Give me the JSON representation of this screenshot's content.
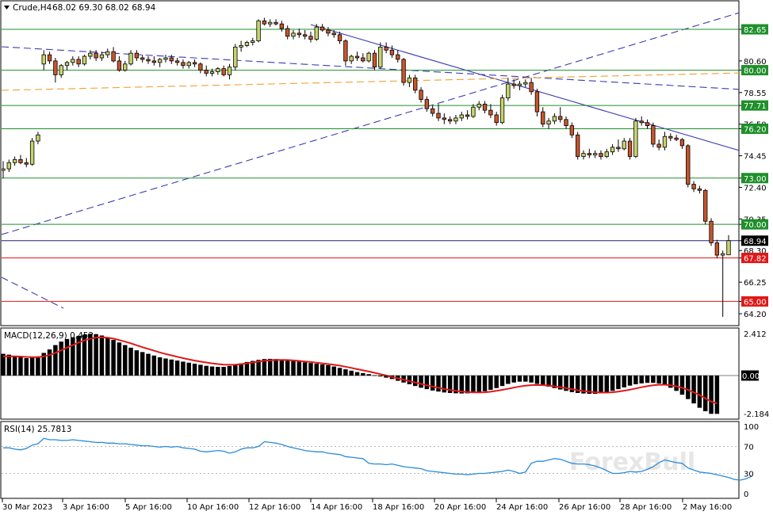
{
  "header": {
    "symbol": "Crude,H4",
    "ohlc": "68.02 69.30 68.02 68.94",
    "macd_label": "MACD(12,26,9) 0.452",
    "rsi_label": "RSI(14) 25.7813"
  },
  "watermark": "ForexBull",
  "colors": {
    "bull": "#c8d46a",
    "bear": "#c8552b",
    "level_green": "#1f8f2a",
    "level_red": "#e01818",
    "current_price": "#1e1e7a",
    "trendline": "#3a3ab4",
    "ma_orange": "#f0a030",
    "macd_signal": "#e01818",
    "rsi_line": "#2a8ad8"
  },
  "chart_data": [
    {
      "type": "candlestick",
      "title": "Crude,H4",
      "y_ticks": [
        "82.65",
        "80.60",
        "80.00",
        "78.55",
        "77.71",
        "76.50",
        "76.20",
        "74.45",
        "73.00",
        "72.40",
        "70.35",
        "70.00",
        "68.94",
        "68.30",
        "67.82",
        "66.25",
        "65.00",
        "64.20"
      ],
      "ylim": [
        63.2,
        84.3
      ],
      "x_labels": [
        "30 Mar 2023",
        "3 Apr 16:00",
        "5 Apr 16:00",
        "10 Apr 16:00",
        "12 Apr 16:00",
        "14 Apr 16:00",
        "18 Apr 16:00",
        "20 Apr 16:00",
        "24 Apr 16:00",
        "26 Apr 16:00",
        "28 Apr 16:00",
        "2 May 16:00"
      ],
      "horizontal_levels": [
        {
          "label": "82.65",
          "value": 82.65,
          "color": "green"
        },
        {
          "label": "80.00",
          "value": 80.0,
          "color": "green"
        },
        {
          "label": "77.71",
          "value": 77.71,
          "color": "green"
        },
        {
          "label": "76.20",
          "value": 76.2,
          "color": "green"
        },
        {
          "label": "73.00",
          "value": 73.0,
          "color": "green"
        },
        {
          "label": "70.00",
          "value": 70.0,
          "color": "green"
        },
        {
          "label": "68.94",
          "value": 68.94,
          "color": "current"
        },
        {
          "label": "67.82",
          "value": 67.82,
          "color": "red"
        },
        {
          "label": "65.00",
          "value": 65.0,
          "color": "red"
        }
      ],
      "candles": [
        [
          73.5,
          74.1,
          73.0,
          73.6
        ],
        [
          73.6,
          74.2,
          73.4,
          74.0
        ],
        [
          74.0,
          74.4,
          73.8,
          74.2
        ],
        [
          74.2,
          74.5,
          73.9,
          74.0
        ],
        [
          74.0,
          74.3,
          73.7,
          73.9
        ],
        [
          73.9,
          75.6,
          73.8,
          75.4
        ],
        [
          75.4,
          76.0,
          75.2,
          75.8
        ],
        [
          80.4,
          81.3,
          80.0,
          81.0
        ],
        [
          81.0,
          81.2,
          80.4,
          80.6
        ],
        [
          80.6,
          80.8,
          79.2,
          79.7
        ],
        [
          79.7,
          80.4,
          79.5,
          80.3
        ],
        [
          80.3,
          80.6,
          80.0,
          80.5
        ],
        [
          80.5,
          80.9,
          80.3,
          80.7
        ],
        [
          80.7,
          80.9,
          80.2,
          80.4
        ],
        [
          80.4,
          81.0,
          80.3,
          80.9
        ],
        [
          80.9,
          81.3,
          80.7,
          81.1
        ],
        [
          81.1,
          81.3,
          80.6,
          80.8
        ],
        [
          80.8,
          81.2,
          80.6,
          81.0
        ],
        [
          81.0,
          81.4,
          80.8,
          81.2
        ],
        [
          81.2,
          81.5,
          80.5,
          80.6
        ],
        [
          80.6,
          80.9,
          79.9,
          80.0
        ],
        [
          80.0,
          80.6,
          79.9,
          80.4
        ],
        [
          80.4,
          81.3,
          80.3,
          81.1
        ],
        [
          81.1,
          81.3,
          80.6,
          80.8
        ],
        [
          80.8,
          81.0,
          80.5,
          80.7
        ],
        [
          80.7,
          80.9,
          80.4,
          80.6
        ],
        [
          80.6,
          80.9,
          80.3,
          80.5
        ],
        [
          80.5,
          80.8,
          80.2,
          80.7
        ],
        [
          80.7,
          81.0,
          80.5,
          80.8
        ],
        [
          80.8,
          81.0,
          80.4,
          80.6
        ],
        [
          80.6,
          80.8,
          80.3,
          80.5
        ],
        [
          80.5,
          80.7,
          80.1,
          80.3
        ],
        [
          80.3,
          80.6,
          80.1,
          80.5
        ],
        [
          80.5,
          80.7,
          80.2,
          80.4
        ],
        [
          80.4,
          80.5,
          79.8,
          80.0
        ],
        [
          80.0,
          80.3,
          79.6,
          79.8
        ],
        [
          79.8,
          80.1,
          79.6,
          79.9
        ],
        [
          79.9,
          80.2,
          79.7,
          80.1
        ],
        [
          80.1,
          80.3,
          79.6,
          79.7
        ],
        [
          79.7,
          80.4,
          79.4,
          80.2
        ],
        [
          80.2,
          81.7,
          80.0,
          81.5
        ],
        [
          81.5,
          81.9,
          81.2,
          81.6
        ],
        [
          81.6,
          81.9,
          81.5,
          81.8
        ],
        [
          81.8,
          82.1,
          81.6,
          81.9
        ],
        [
          81.9,
          83.3,
          81.8,
          83.2
        ],
        [
          83.2,
          83.4,
          82.9,
          83.0
        ],
        [
          83.0,
          83.3,
          82.8,
          83.1
        ],
        [
          83.1,
          83.3,
          82.9,
          83.0
        ],
        [
          83.0,
          83.2,
          82.5,
          82.7
        ],
        [
          82.7,
          82.9,
          82.0,
          82.2
        ],
        [
          82.2,
          82.6,
          82.0,
          82.4
        ],
        [
          82.4,
          82.7,
          82.1,
          82.3
        ],
        [
          82.3,
          82.6,
          82.0,
          82.2
        ],
        [
          82.2,
          82.5,
          81.8,
          82.0
        ],
        [
          82.0,
          83.0,
          81.9,
          82.8
        ],
        [
          82.8,
          83.0,
          82.5,
          82.6
        ],
        [
          82.6,
          82.8,
          82.2,
          82.4
        ],
        [
          82.4,
          82.6,
          82.1,
          82.3
        ],
        [
          82.3,
          82.5,
          81.7,
          81.9
        ],
        [
          81.9,
          82.0,
          80.3,
          80.6
        ],
        [
          80.6,
          81.0,
          80.4,
          80.9
        ],
        [
          80.9,
          81.2,
          80.6,
          80.8
        ],
        [
          80.8,
          81.1,
          80.5,
          80.6
        ],
        [
          80.6,
          81.2,
          80.5,
          81.1
        ],
        [
          81.1,
          81.3,
          80.0,
          80.2
        ],
        [
          80.2,
          81.8,
          80.1,
          81.5
        ],
        [
          81.5,
          81.8,
          81.1,
          81.3
        ],
        [
          81.3,
          81.6,
          80.8,
          81.0
        ],
        [
          81.0,
          81.3,
          80.5,
          80.7
        ],
        [
          80.7,
          80.8,
          79.0,
          79.2
        ],
        [
          79.2,
          79.7,
          78.9,
          79.5
        ],
        [
          79.5,
          79.7,
          78.5,
          78.7
        ],
        [
          78.7,
          78.9,
          77.9,
          78.1
        ],
        [
          78.1,
          78.3,
          77.3,
          77.5
        ],
        [
          77.5,
          77.7,
          77.0,
          77.2
        ],
        [
          77.2,
          77.8,
          76.7,
          76.9
        ],
        [
          76.9,
          77.2,
          76.5,
          76.8
        ],
        [
          76.8,
          77.0,
          76.5,
          76.7
        ],
        [
          76.7,
          77.1,
          76.5,
          76.9
        ],
        [
          76.9,
          77.3,
          76.7,
          77.1
        ],
        [
          77.1,
          77.4,
          76.8,
          77.0
        ],
        [
          77.0,
          77.8,
          76.9,
          77.6
        ],
        [
          77.6,
          78.0,
          77.4,
          77.8
        ],
        [
          77.8,
          78.0,
          77.2,
          77.4
        ],
        [
          77.4,
          77.8,
          76.9,
          77.1
        ],
        [
          77.1,
          77.3,
          76.4,
          76.6
        ],
        [
          76.6,
          78.4,
          76.5,
          78.2
        ],
        [
          78.2,
          79.5,
          78.0,
          79.1
        ],
        [
          79.1,
          79.4,
          78.8,
          79.0
        ],
        [
          79.0,
          79.3,
          78.7,
          79.1
        ],
        [
          79.1,
          79.4,
          78.9,
          79.2
        ],
        [
          79.2,
          79.5,
          78.4,
          78.6
        ],
        [
          78.6,
          78.8,
          77.0,
          77.3
        ],
        [
          77.3,
          77.6,
          76.3,
          76.5
        ],
        [
          76.5,
          76.9,
          76.2,
          76.7
        ],
        [
          76.7,
          77.2,
          76.5,
          77.0
        ],
        [
          77.0,
          77.6,
          76.6,
          76.8
        ],
        [
          76.8,
          77.0,
          76.2,
          76.4
        ],
        [
          76.4,
          76.6,
          75.6,
          75.8
        ],
        [
          75.8,
          76.0,
          74.2,
          74.4
        ],
        [
          74.4,
          74.8,
          74.2,
          74.6
        ],
        [
          74.6,
          74.9,
          74.3,
          74.5
        ],
        [
          74.5,
          74.8,
          74.3,
          74.6
        ],
        [
          74.6,
          74.8,
          74.2,
          74.4
        ],
        [
          74.4,
          74.9,
          74.3,
          74.7
        ],
        [
          74.7,
          75.2,
          74.5,
          75.0
        ],
        [
          75.0,
          75.5,
          74.7,
          74.9
        ],
        [
          74.9,
          75.6,
          74.8,
          75.4
        ],
        [
          75.4,
          75.6,
          74.2,
          74.4
        ],
        [
          74.4,
          76.9,
          74.3,
          76.7
        ],
        [
          76.7,
          77.0,
          76.4,
          76.6
        ],
        [
          76.6,
          76.8,
          76.2,
          76.4
        ],
        [
          76.4,
          76.6,
          75.0,
          75.2
        ],
        [
          75.2,
          75.5,
          74.8,
          75.0
        ],
        [
          75.0,
          76.0,
          74.8,
          75.7
        ],
        [
          75.7,
          75.9,
          75.4,
          75.6
        ],
        [
          75.6,
          75.8,
          75.4,
          75.5
        ],
        [
          75.5,
          75.6,
          74.9,
          75.1
        ],
        [
          75.1,
          75.2,
          72.4,
          72.6
        ],
        [
          72.6,
          72.8,
          72.1,
          72.3
        ],
        [
          72.3,
          72.5,
          72.0,
          72.2
        ],
        [
          72.2,
          72.3,
          70.0,
          70.2
        ],
        [
          70.2,
          70.4,
          68.6,
          68.8
        ],
        [
          68.8,
          69.0,
          67.8,
          68.0
        ],
        [
          68.0,
          68.3,
          64.0,
          68.1
        ],
        [
          68.02,
          69.3,
          68.02,
          68.94
        ]
      ],
      "trendlines": [
        {
          "name": "downtrend",
          "style": "solid"
        },
        {
          "name": "long descending",
          "style": "dashed"
        },
        {
          "name": "ascending",
          "style": "dashed"
        },
        {
          "name": "moving average",
          "style": "dashed",
          "color": "orange"
        }
      ]
    },
    {
      "type": "bar",
      "title": "MACD(12,26,9) 0.452",
      "y_ticks": [
        "2.412",
        "0.00",
        "-2.184"
      ],
      "ylim": [
        -2.45,
        2.65
      ],
      "histogram": [
        1.25,
        1.2,
        1.1,
        1.05,
        1.0,
        1.02,
        1.1,
        1.3,
        1.5,
        1.75,
        1.95,
        2.1,
        2.2,
        2.28,
        2.35,
        2.4,
        2.38,
        2.3,
        2.2,
        2.05,
        1.9,
        1.75,
        1.6,
        1.45,
        1.35,
        1.25,
        1.15,
        1.05,
        0.98,
        0.92,
        0.86,
        0.8,
        0.74,
        0.68,
        0.62,
        0.56,
        0.52,
        0.5,
        0.5,
        0.55,
        0.62,
        0.7,
        0.78,
        0.84,
        0.9,
        0.95,
        0.96,
        0.95,
        0.92,
        0.88,
        0.84,
        0.8,
        0.76,
        0.72,
        0.68,
        0.64,
        0.6,
        0.52,
        0.44,
        0.36,
        0.28,
        0.2,
        0.14,
        0.08,
        0.02,
        -0.05,
        -0.12,
        -0.2,
        -0.3,
        -0.4,
        -0.5,
        -0.6,
        -0.7,
        -0.78,
        -0.86,
        -0.92,
        -0.97,
        -1.0,
        -1.02,
        -1.03,
        -1.02,
        -1.0,
        -0.96,
        -0.9,
        -0.82,
        -0.72,
        -0.6,
        -0.48,
        -0.4,
        -0.35,
        -0.35,
        -0.4,
        -0.48,
        -0.56,
        -0.64,
        -0.72,
        -0.8,
        -0.88,
        -0.95,
        -1.0,
        -1.03,
        -1.05,
        -1.05,
        -1.02,
        -0.96,
        -0.88,
        -0.78,
        -0.68,
        -0.58,
        -0.5,
        -0.45,
        -0.42,
        -0.42,
        -0.46,
        -0.55,
        -0.7,
        -0.88,
        -1.1,
        -1.35,
        -1.6,
        -1.85,
        -2.05,
        -2.2,
        -2.2
      ],
      "signal": [
        1.1,
        1.1,
        1.1,
        1.09,
        1.07,
        1.06,
        1.06,
        1.1,
        1.18,
        1.3,
        1.45,
        1.6,
        1.75,
        1.9,
        2.02,
        2.12,
        2.18,
        2.2,
        2.18,
        2.12,
        2.04,
        1.95,
        1.85,
        1.74,
        1.63,
        1.53,
        1.43,
        1.33,
        1.24,
        1.16,
        1.08,
        1.0,
        0.93,
        0.86,
        0.8,
        0.75,
        0.7,
        0.66,
        0.63,
        0.62,
        0.63,
        0.66,
        0.7,
        0.75,
        0.8,
        0.85,
        0.88,
        0.9,
        0.9,
        0.89,
        0.87,
        0.84,
        0.81,
        0.78,
        0.74,
        0.7,
        0.66,
        0.62,
        0.57,
        0.51,
        0.44,
        0.37,
        0.3,
        0.23,
        0.16,
        0.08,
        0.0,
        -0.08,
        -0.16,
        -0.24,
        -0.32,
        -0.4,
        -0.48,
        -0.56,
        -0.63,
        -0.7,
        -0.77,
        -0.83,
        -0.88,
        -0.92,
        -0.95,
        -0.97,
        -0.97,
        -0.96,
        -0.93,
        -0.88,
        -0.82,
        -0.76,
        -0.69,
        -0.63,
        -0.58,
        -0.55,
        -0.54,
        -0.55,
        -0.58,
        -0.62,
        -0.67,
        -0.72,
        -0.78,
        -0.84,
        -0.89,
        -0.93,
        -0.96,
        -0.98,
        -0.98,
        -0.96,
        -0.92,
        -0.87,
        -0.81,
        -0.74,
        -0.67,
        -0.61,
        -0.56,
        -0.53,
        -0.53,
        -0.56,
        -0.62,
        -0.7,
        -0.82,
        -0.96,
        -1.12,
        -1.3,
        -1.5,
        -1.6
      ]
    },
    {
      "type": "line",
      "title": "RSI(14) 25.7813",
      "y_ticks": [
        "100",
        "70",
        "30",
        "0"
      ],
      "ylim": [
        0,
        100
      ],
      "levels": [
        70,
        30
      ],
      "values": [
        68,
        68,
        66,
        65,
        67,
        72,
        74,
        82,
        80,
        80,
        79,
        79,
        80,
        79,
        78,
        77,
        76,
        76,
        75,
        75,
        74,
        74,
        73,
        72,
        71,
        71,
        70,
        69,
        70,
        69,
        70,
        68,
        67,
        66,
        63,
        62,
        63,
        64,
        63,
        60,
        62,
        66,
        68,
        68,
        70,
        77,
        76,
        75,
        73,
        70,
        68,
        66,
        64,
        63,
        62,
        62,
        60,
        59,
        58,
        55,
        54,
        53,
        52,
        45,
        44,
        44,
        43,
        44,
        42,
        40,
        39,
        38,
        37,
        34,
        33,
        32,
        31,
        30,
        29,
        29,
        28,
        29,
        30,
        30,
        31,
        32,
        33,
        35,
        33,
        30,
        32,
        45,
        48,
        48,
        50,
        52,
        51,
        48,
        45,
        44,
        44,
        43,
        41,
        38,
        34,
        30,
        30,
        31,
        33,
        32,
        33,
        36,
        40,
        46,
        50,
        48,
        46,
        45,
        38,
        35,
        32,
        31,
        30,
        28,
        26,
        24,
        21,
        20,
        22,
        26
      ]
    }
  ]
}
